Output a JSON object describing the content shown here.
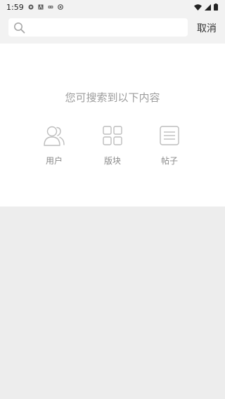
{
  "status_bar": {
    "time": "1:59",
    "left_icons": [
      "notification-app-icon",
      "notification-a-icon",
      "notification-dots-icon",
      "notification-at-icon"
    ],
    "right_icons": [
      "wifi-icon",
      "signal-icon",
      "battery-icon"
    ]
  },
  "search": {
    "placeholder": "",
    "value": "",
    "cancel_label": "取消"
  },
  "content": {
    "hint": "您可搜索到以下内容",
    "categories": [
      {
        "label": "用户",
        "icon": "user-icon"
      },
      {
        "label": "版块",
        "icon": "grid-icon"
      },
      {
        "label": "帖子",
        "icon": "post-icon"
      }
    ]
  }
}
